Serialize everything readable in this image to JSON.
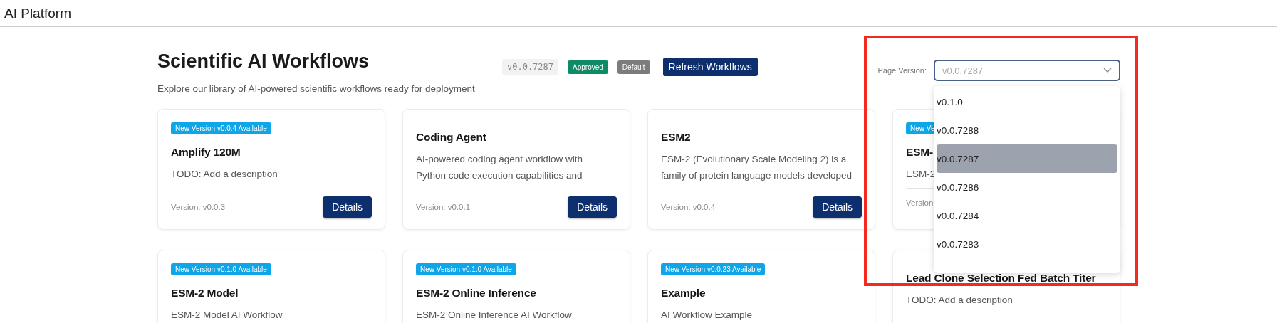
{
  "app_bar": {
    "title": "AI Platform"
  },
  "header": {
    "title": "Scientific AI Workflows",
    "subtitle": "Explore our library of AI-powered scientific workflows ready for deployment",
    "version_tag": "v0.0.7287",
    "badges": [
      {
        "label": "Approved",
        "color": "#0e8a66"
      },
      {
        "label": "Default",
        "color": "#7c7c7c"
      }
    ],
    "refresh_button": "Refresh Workflows"
  },
  "page_version": {
    "label": "Page Version:",
    "placeholder": "v0.0.7287",
    "expanded": true,
    "options": [
      {
        "label": "v0.1.0",
        "selected": false
      },
      {
        "label": "v0.0.7288",
        "selected": false
      },
      {
        "label": "v0.0.7287",
        "selected": true
      },
      {
        "label": "v0.0.7286",
        "selected": false
      },
      {
        "label": "v0.0.7284",
        "selected": false
      },
      {
        "label": "v0.0.7283",
        "selected": false
      }
    ]
  },
  "cards": [
    {
      "badge": "New Version v0.0.4 Available",
      "title": "Amplify 120M",
      "description": "TODO: Add a description",
      "version": "Version: v0.0.3",
      "button": "Details"
    },
    {
      "title": "Coding Agent",
      "description": "AI-powered coding agent workflow with Python code execution capabilities and",
      "version": "Version: v0.0.1",
      "button": "Details"
    },
    {
      "title": "ESM2",
      "description": "ESM-2 (Evolutionary Scale Modeling 2) is a family of protein language models developed",
      "version": "Version: v0.0.4",
      "button": "Details"
    },
    {
      "badge": "New Ve",
      "title": "ESM-",
      "description": "ESM-2",
      "version": "Version"
    },
    {
      "badge": "New Version v0.1.0 Available",
      "title": "ESM-2 Model",
      "description": "ESM-2 Model AI Workflow"
    },
    {
      "badge": "New Version v0.1.0 Available",
      "title": "ESM-2 Online Inference",
      "description": "ESM-2 Online Inference AI Workflow"
    },
    {
      "badge": "New Version v0.0.23 Available",
      "title": "Example",
      "description": "AI Workflow Example"
    },
    {
      "title": "Lead Clone Selection Fed Batch Titer",
      "description": "TODO: Add a description"
    }
  ],
  "highlight_frame": true
}
